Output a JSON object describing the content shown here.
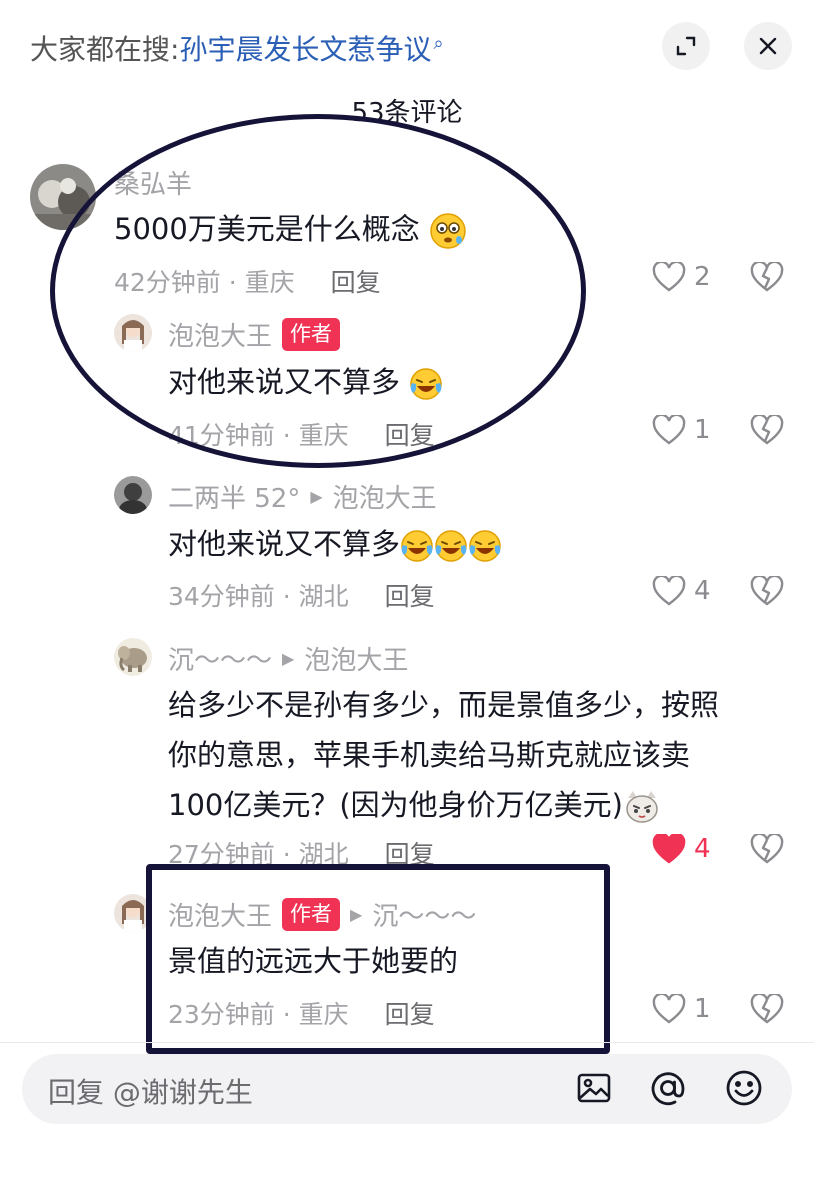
{
  "header": {
    "prefix": "大家都在搜:",
    "topic": "孙宇晨发长文惹争议",
    "count": "53条评论"
  },
  "comments": [
    {
      "user": "桑弘羊",
      "text": "5000万美元是什么概念",
      "emoji": "pleading-face",
      "time": "42分钟前 · 重庆",
      "reply": "回复",
      "likes": "2",
      "liked": false
    },
    {
      "user": "泡泡大王",
      "author_tag": "作者",
      "text": "对他来说又不算多",
      "emoji": "crying-laughing-face",
      "time": "41分钟前 · 重庆",
      "reply": "回复",
      "likes": "1",
      "liked": false
    },
    {
      "user": "二两半 52°",
      "reply_to": "泡泡大王",
      "text": "对他来说又不算多",
      "emoji": "crying-laughing-face",
      "emoji_count": 3,
      "time": "34分钟前 · 湖北",
      "reply": "回复",
      "likes": "4",
      "liked": false
    },
    {
      "user": "沉～～～",
      "reply_to": "泡泡大王",
      "text_lines": [
        "给多少不是孙有多少，而是景值多少，按照",
        "你的意思，苹果手机卖给马斯克就应该卖",
        "100亿美元？(因为他身价万亿美元)"
      ],
      "emoji": "cat-face",
      "time": "27分钟前 · 湖北",
      "reply": "回复",
      "likes": "4",
      "liked": true
    },
    {
      "user": "泡泡大王",
      "author_tag": "作者",
      "reply_to": "沉～～～",
      "text": "景值的远远大于她要的",
      "time": "23分钟前 · 重庆",
      "reply": "回复",
      "likes": "1",
      "liked": false
    }
  ],
  "input": {
    "placeholder": "回复 @谢谢先生"
  },
  "icons": [
    "search-mini-icon",
    "expand-icon",
    "close-icon",
    "heart-icon",
    "broken-heart-icon",
    "image-icon",
    "at-icon",
    "smiley-icon"
  ],
  "colors": {
    "accent": "#f03355",
    "topic_link": "#2b5eb5",
    "annotation": "#151338"
  }
}
